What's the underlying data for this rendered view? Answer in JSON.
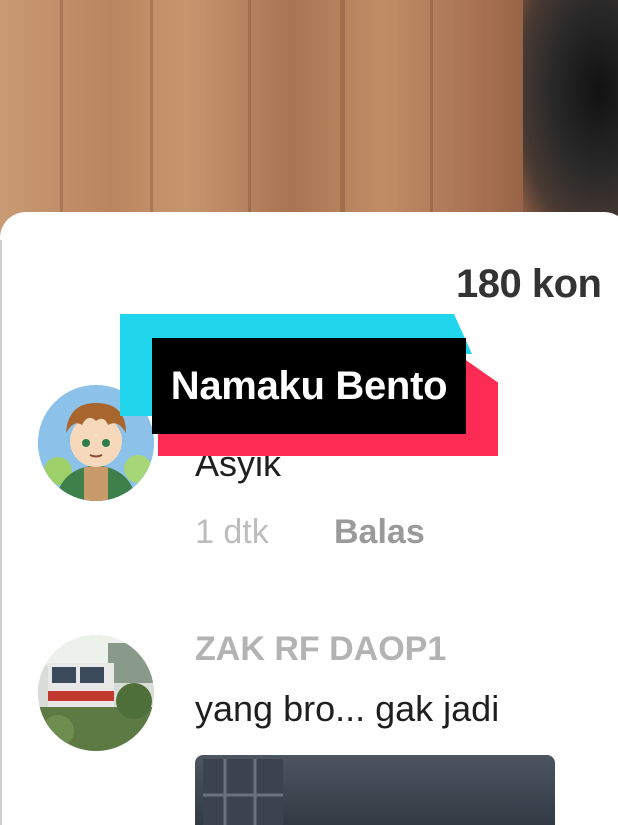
{
  "video": {
    "background_description_color": "#b98a66"
  },
  "comments": {
    "count_label": "180 kon",
    "items": [
      {
        "avatar_icon": "anime-character-avatar-icon",
        "text": "Asyik",
        "time": "1 dtk",
        "reply_label": "Balas"
      },
      {
        "avatar_icon": "train-photo-avatar-icon",
        "username": "ZAK RF DAOP1",
        "text": "yang bro... gak jadi"
      }
    ]
  },
  "caption": {
    "text": "Namaku Bento",
    "colors": {
      "cyan": "#20d5ec",
      "red": "#fe2c55",
      "black": "#000000"
    }
  }
}
